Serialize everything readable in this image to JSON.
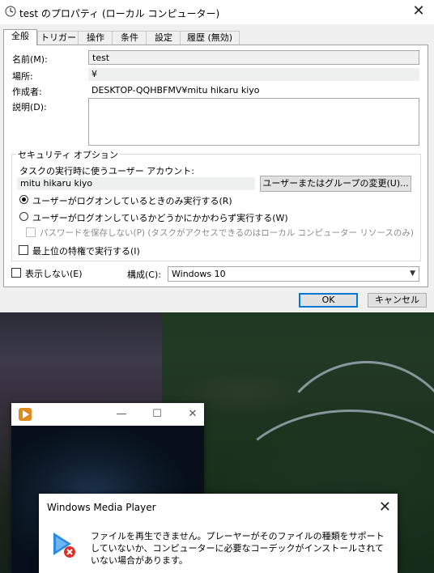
{
  "window": {
    "title": "test のプロパティ (ローカル コンピューター)",
    "close": "✕"
  },
  "tabs": [
    "全般",
    "トリガー",
    "操作",
    "条件",
    "設定",
    "履歴 (無効)"
  ],
  "general": {
    "name_label": "名前(M):",
    "name_value": "test",
    "location_label": "場所:",
    "location_value": "¥",
    "author_label": "作成者:",
    "author_value": "DESKTOP-QQHBFMV¥mitu hikaru kiyo",
    "description_label": "説明(D):",
    "description_value": ""
  },
  "security": {
    "title": "セキュリティ オプション",
    "account_label": "タスクの実行時に使うユーザー アカウント:",
    "account_value": "mitu hikaru kiyo",
    "change_button": "ユーザーまたはグループの変更(U)...",
    "radio_logged_on": "ユーザーがログオンしているときのみ実行する(R)",
    "radio_whether": "ユーザーがログオンしているかどうかにかかわらず実行する(W)",
    "no_store_password": "パスワードを保存しない(P) (タスクがアクセスできるのはローカル コンピューター リソースのみ)",
    "highest_privileges": "最上位の特権で実行する(I)",
    "radio_selected": "logged_on"
  },
  "footer": {
    "hidden_label": "表示しない(E)",
    "config_label": "構成(C):",
    "config_value": "Windows 10",
    "ok": "OK",
    "cancel": "キャンセル"
  },
  "media_player": {
    "minimize": "—",
    "maximize": "☐",
    "close": "✕"
  },
  "error_dialog": {
    "title": "Windows Media Player",
    "close": "✕",
    "message": "ファイルを再生できません。プレーヤーがそのファイルの種類をサポートしていないか、コンピューターに必要なコーデックがインストールされていない場合があります。"
  },
  "colors": {
    "accent": "#0078d7",
    "dialog_bg": "#f0f0f0"
  }
}
